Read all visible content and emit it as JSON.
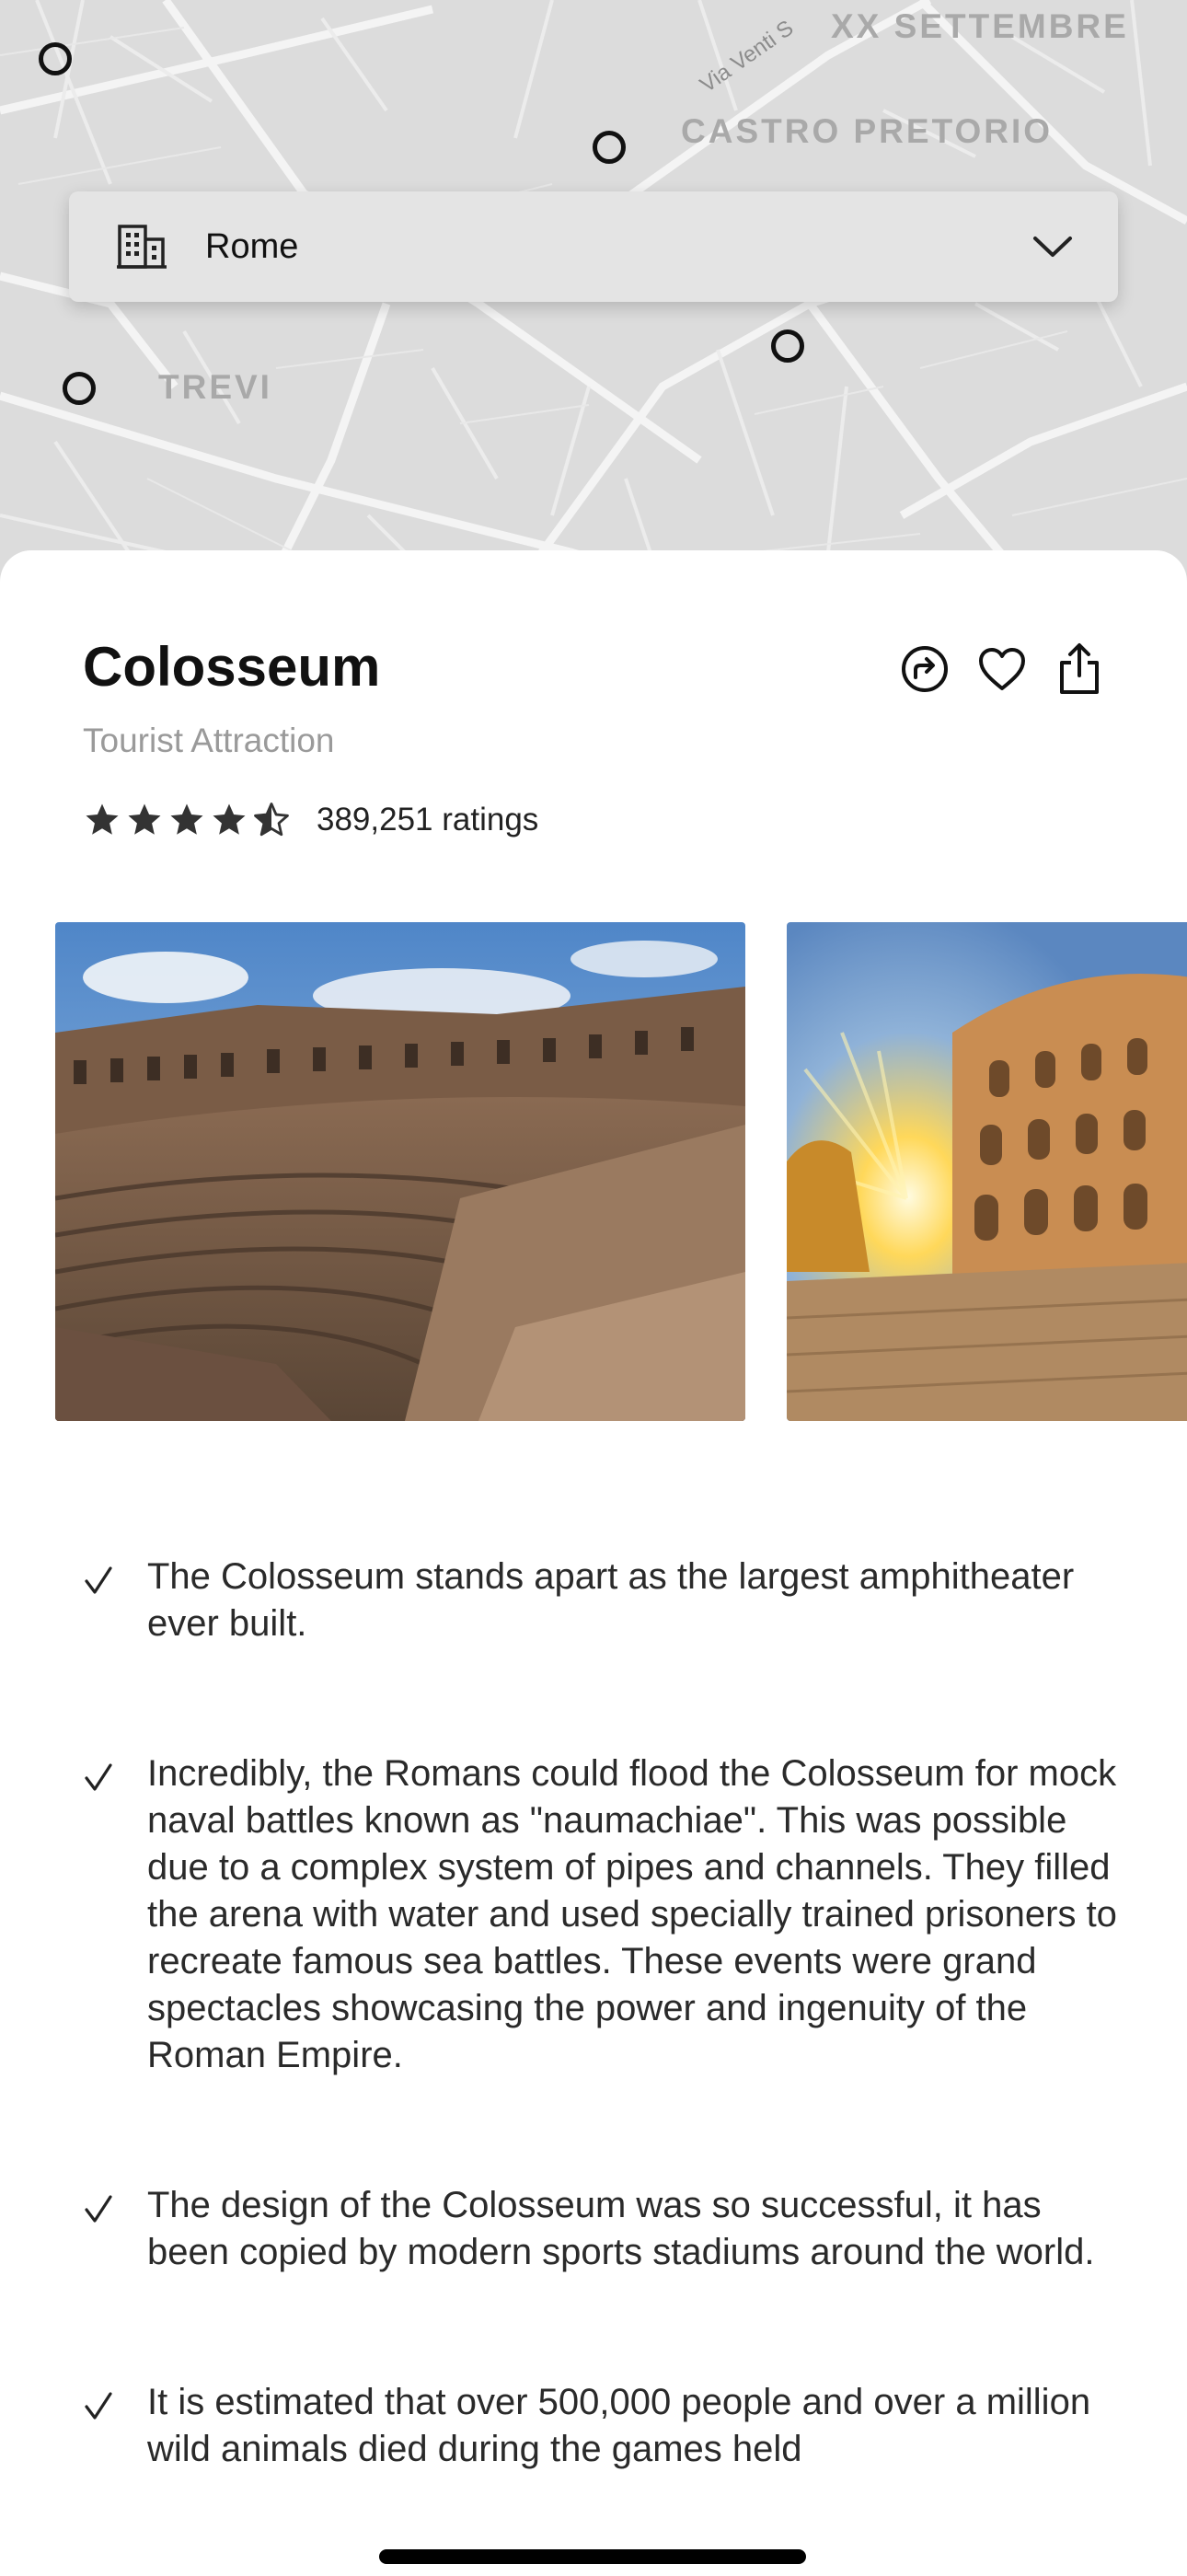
{
  "map": {
    "districts": [
      "XX SETTEMBRE",
      "CASTRO PRETORIO",
      "TREVI"
    ],
    "street": "Via Venti S",
    "city_selector": {
      "value": "Rome",
      "icon": "building-icon",
      "chevron": "chevron-down-icon"
    }
  },
  "place": {
    "title": "Colosseum",
    "category": "Tourist Attraction",
    "rating": 4.5,
    "rating_max": 5,
    "ratings_label": "389,251 ratings",
    "actions": [
      "directions-icon",
      "heart-icon",
      "share-icon"
    ]
  },
  "photos": [
    {
      "description_icon": "colosseum-interior-photo"
    },
    {
      "description_icon": "colosseum-sunset-photo"
    }
  ],
  "facts": [
    "The Colosseum stands apart as the largest amphitheater ever built.",
    "Incredibly, the Romans could flood the Colosseum for mock naval battles known as \"naumachiae\". This was possible due to a complex system of pipes and channels. They filled the arena with water and used specially trained prisoners to recreate famous sea battles. These events were grand spectacles showcasing the power and ingenuity of the Roman Empire.",
    "The design of the Colosseum was so successful, it has been copied by modern sports stadiums around the world.",
    "It is estimated that over 500,000 people and over a million wild animals died during the games held"
  ],
  "colors": {
    "map_bg": "#dcdcdc",
    "sheet_bg": "#ffffff",
    "muted_text": "#9a9a9a"
  }
}
